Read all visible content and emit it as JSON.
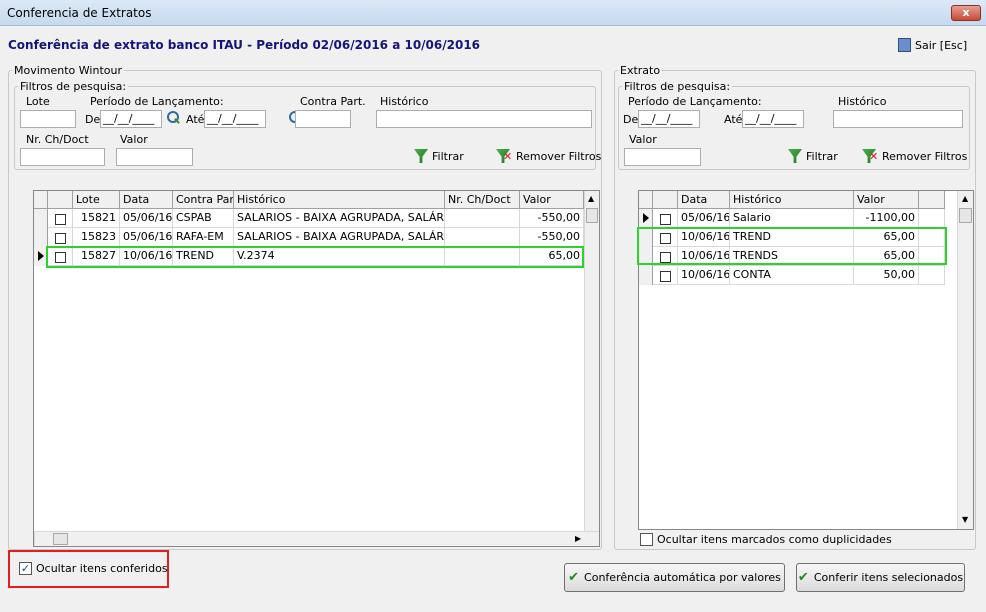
{
  "window": {
    "title": "Conferencia de Extratos",
    "close": "x"
  },
  "heading": "Conferência de extrato banco ITAU - Período 02/06/2016 a 10/06/2016",
  "exit_label": "Sair [Esc]",
  "left_panel": {
    "group_title": "Movimento Wintour",
    "filters_title": "Filtros de pesquisa:",
    "lote_label": "Lote",
    "periodo_label": "Período de Lançamento:",
    "de_label": "De",
    "de_value": "__/__/____",
    "ate_label": "Até",
    "ate_value": "__/__/____",
    "contra_label": "Contra Part.",
    "historico_label": "Histórico",
    "nrch_label": "Nr. Ch/Doct",
    "valor_label": "Valor",
    "filtrar": "Filtrar",
    "remover": "Remover Filtros",
    "columns": [
      "Lote",
      "Data",
      "Contra Part.",
      "Histórico",
      "Nr. Ch/Doct",
      "Valor"
    ],
    "rows": [
      {
        "lote": "15821",
        "data": "05/06/16",
        "contra": "CSPAB",
        "hist": "SALARIOS - BAIXA AGRUPADA, SALÁRIO",
        "nr": "",
        "valor": "-550,00"
      },
      {
        "lote": "15823",
        "data": "05/06/16",
        "contra": "RAFA-EM",
        "hist": "SALARIOS - BAIXA AGRUPADA, SALÁRIO",
        "nr": "",
        "valor": "-550,00"
      },
      {
        "lote": "15827",
        "data": "10/06/16",
        "contra": "TREND",
        "hist": "V.2374",
        "nr": "",
        "valor": "65,00"
      }
    ],
    "hide_checked_label": "Ocultar itens conferidos",
    "hide_checked": true
  },
  "right_panel": {
    "group_title": "Extrato",
    "filters_title": "Filtros de pesquisa:",
    "periodo_label": "Período de Lançamento:",
    "de_label": "De",
    "de_value": "__/__/____",
    "ate_label": "Até",
    "ate_value": "__/__/____",
    "historico_label": "Histórico",
    "valor_label": "Valor",
    "filtrar": "Filtrar",
    "remover": "Remover Filtros",
    "columns": [
      "Data",
      "Histórico",
      "Valor"
    ],
    "rows": [
      {
        "data": "05/06/16",
        "hist": "Salario",
        "valor": "-1100,00"
      },
      {
        "data": "10/06/16",
        "hist": "TREND",
        "valor": "65,00"
      },
      {
        "data": "10/06/16",
        "hist": "TRENDS",
        "valor": "65,00"
      },
      {
        "data": "10/06/16",
        "hist": "CONTA",
        "valor": "50,00"
      }
    ],
    "hide_dup_label": "Ocultar itens marcados como duplicidades"
  },
  "buttons": {
    "auto": "Conferência automática por valores",
    "confirm": "Conferir itens selecionados"
  },
  "colors": {
    "heading": "#14147a",
    "highlight_green": "#2fd12f",
    "highlight_red": "#e02020"
  }
}
